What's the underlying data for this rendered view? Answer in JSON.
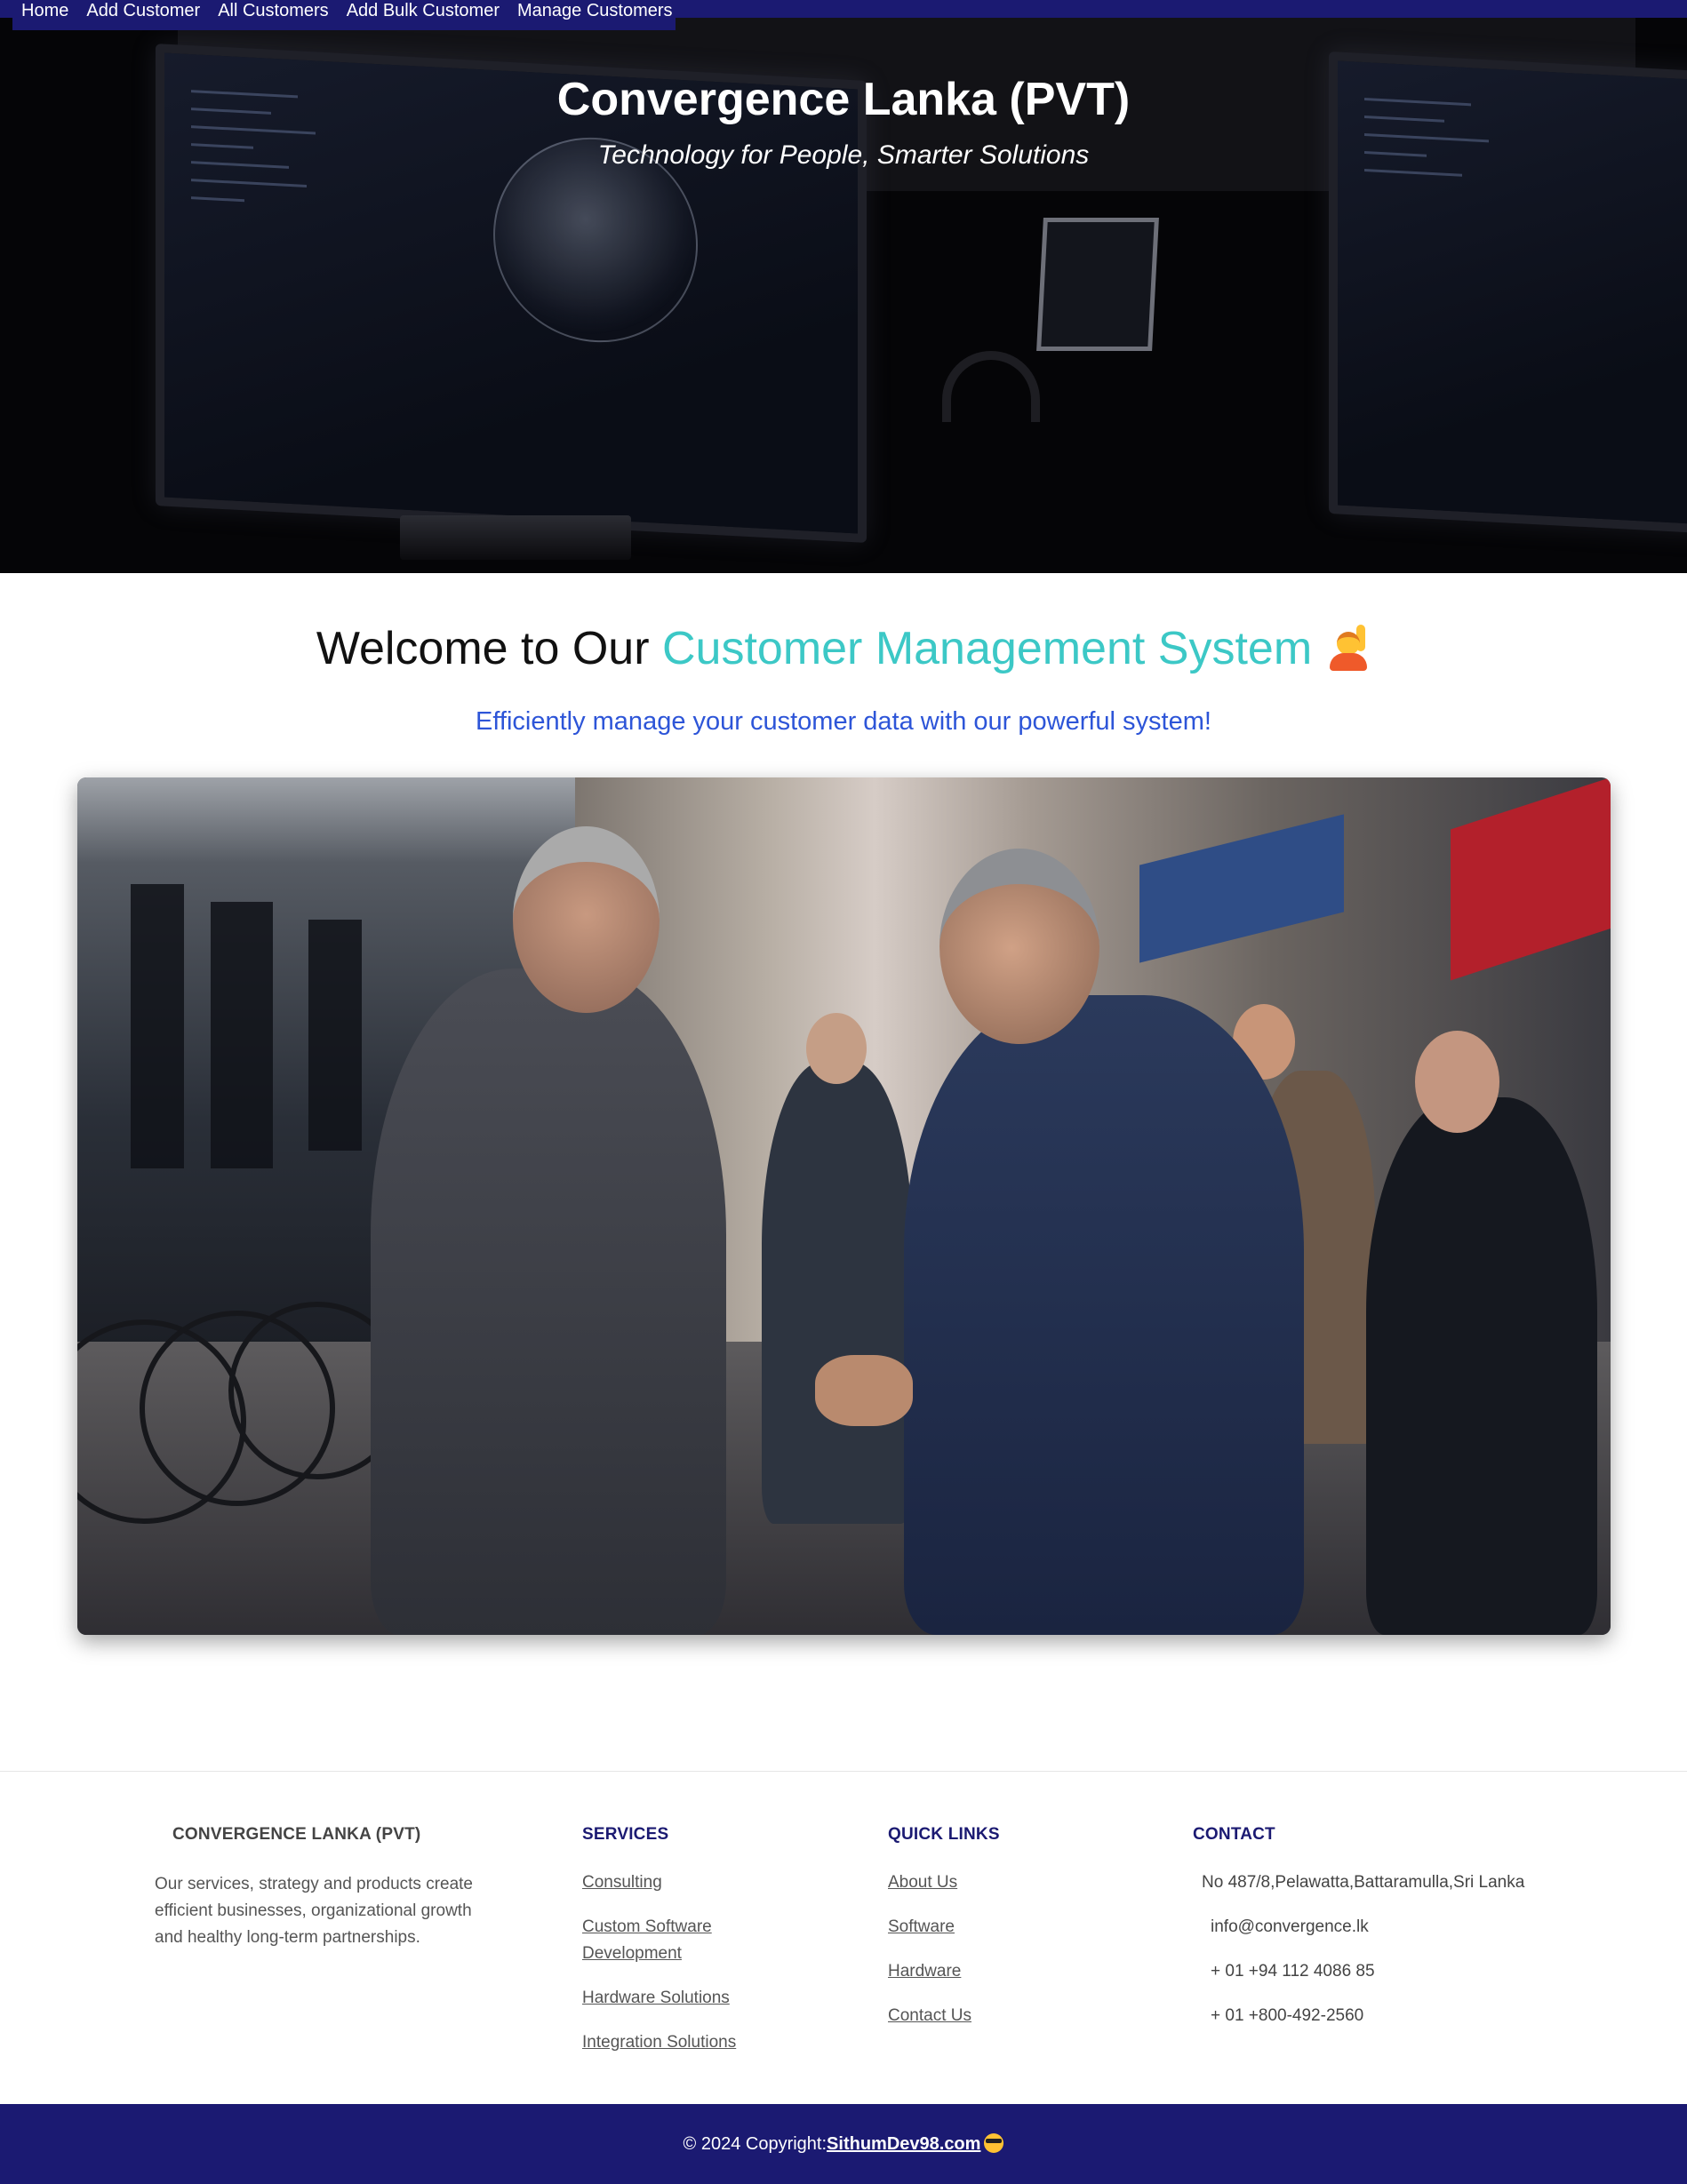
{
  "nav": {
    "items": [
      {
        "label": "Home"
      },
      {
        "label": "Add Customer"
      },
      {
        "label": "All Customers"
      },
      {
        "label": "Add Bulk Customer"
      },
      {
        "label": "Manage Customers"
      }
    ]
  },
  "hero": {
    "title": "Convergence Lanka (PVT)",
    "tagline": "Technology for People, Smarter Solutions"
  },
  "welcome": {
    "prefix": "Welcome to Our ",
    "highlight": "Customer Management System",
    "icon": "person-raising-hand-icon",
    "accent_color": "#3cc8c6",
    "subtitle": "Efficiently manage your customer data with our powerful system!",
    "subtitle_color": "#2d55d8"
  },
  "footer": {
    "brand": {
      "title": "CONVERGENCE LANKA (PVT)",
      "description": "Our services, strategy and products create efficient businesses, organizational growth and healthy long-term partnerships."
    },
    "services": {
      "title": "SERVICES",
      "links": [
        "Consulting",
        "Custom Software Development",
        "Hardware Solutions",
        "Integration Solutions"
      ]
    },
    "quick_links": {
      "title": "QUICK LINKS",
      "links": [
        "About Us",
        "Software",
        "Hardware",
        "Contact Us"
      ]
    },
    "contact": {
      "title": "CONTACT",
      "address": "No 487/8,Pelawatta,Battaramulla,Sri Lanka",
      "email": "info@convergence.lk",
      "phone1": "+ 01 +94 112 4086 85",
      "phone2": "+ 01 +800-492-2560"
    }
  },
  "copyright": {
    "text": "© 2024 Copyright:",
    "link": "SithumDev98.com",
    "icon": "sunglasses-face-icon"
  },
  "colors": {
    "nav_bg": "#1b1a72",
    "footer_heading": "#1b1a72"
  }
}
